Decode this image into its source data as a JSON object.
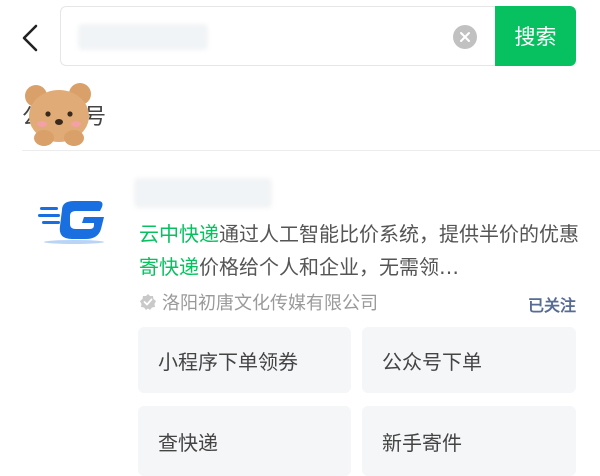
{
  "search": {
    "button_label": "搜索"
  },
  "tab_peek": "公号",
  "account": {
    "description_parts": [
      {
        "text": "云中快递",
        "highlight": true
      },
      {
        "text": "通过人工智能比价系统，提供半价的优惠",
        "highlight": false
      },
      {
        "text": "寄快递",
        "highlight": true
      },
      {
        "text": "价格给个人和企业，无需领…",
        "highlight": false
      }
    ],
    "owner": "洛阳初唐文化传媒有限公司",
    "follow_status": "已关注"
  },
  "menu": [
    {
      "label": "小程序下单领券"
    },
    {
      "label": "公众号下单"
    },
    {
      "label": "查快递"
    },
    {
      "label": "新手寄件"
    }
  ],
  "colors": {
    "accent": "#07c160",
    "link": "#576b95",
    "logo_blue": "#1a6fe0"
  }
}
